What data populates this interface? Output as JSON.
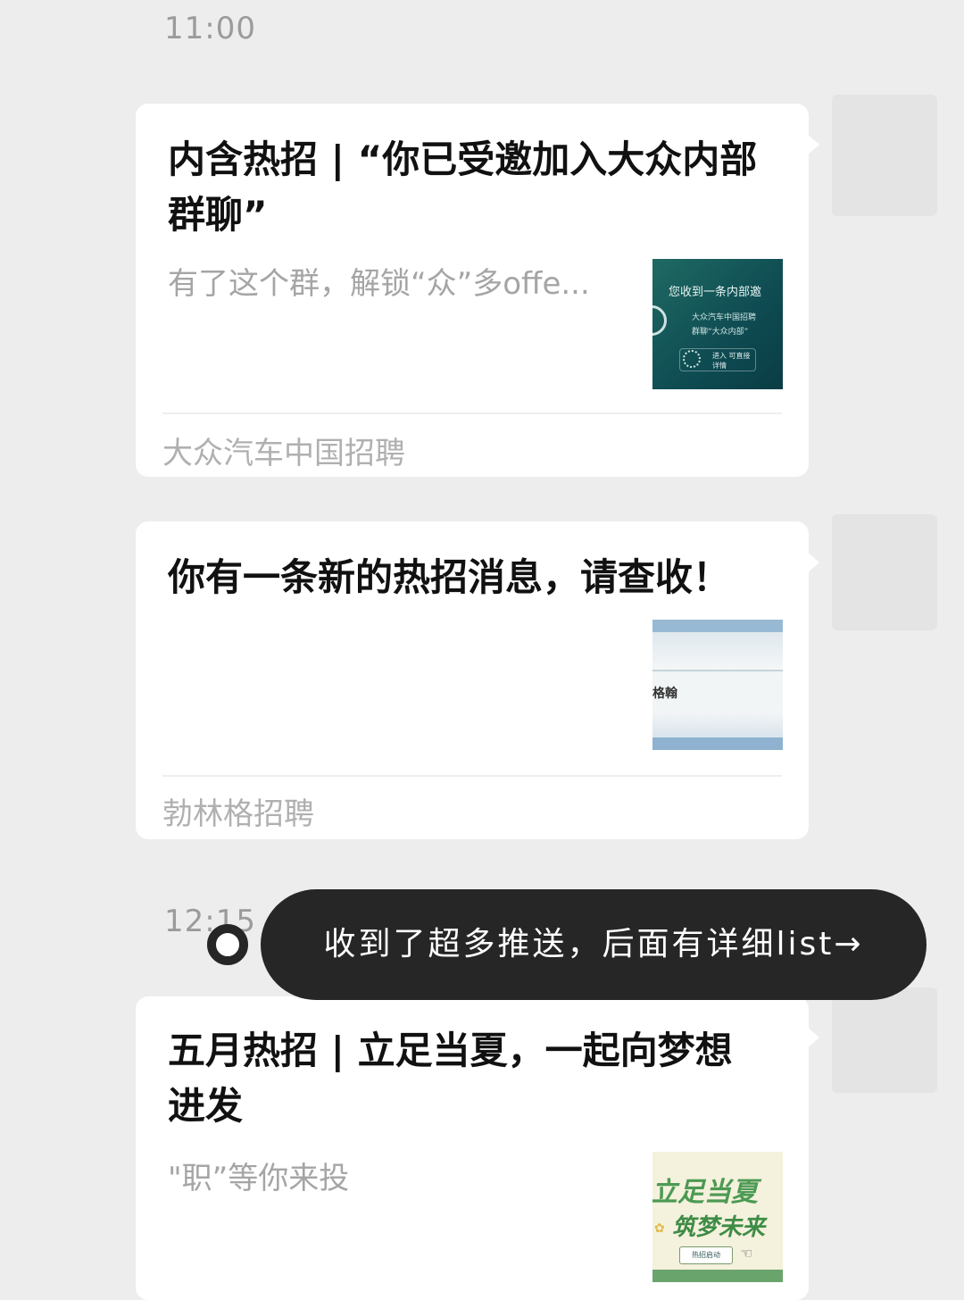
{
  "times": [
    "11:00",
    "12:15"
  ],
  "cards": [
    {
      "title": "内含热招 | “你已受邀加入大众内部群聊”",
      "desc": "有了这个群，解锁“众”多offe...",
      "source": "大众汽车中国招聘",
      "thumb": {
        "notice": "您收到一条内部邀",
        "sub1": "大众汽车中国招聘",
        "sub2": "群聊“大众内部”",
        "enter": "进入 可直接详情"
      }
    },
    {
      "title": "你有一条新的热招消息，请查收！",
      "desc": "",
      "source": "勃林格招聘",
      "thumb": {
        "text": "格翰"
      }
    },
    {
      "title": "五月热招 | 立足当夏，一起向梦想进发",
      "desc": "\"职”等你来投",
      "source": "",
      "thumb": {
        "line1": "立足当夏",
        "line2": "筑梦未来",
        "button": "热招启动"
      }
    }
  ],
  "toast": {
    "text": "收到了超多推送，后面有详细list→"
  }
}
